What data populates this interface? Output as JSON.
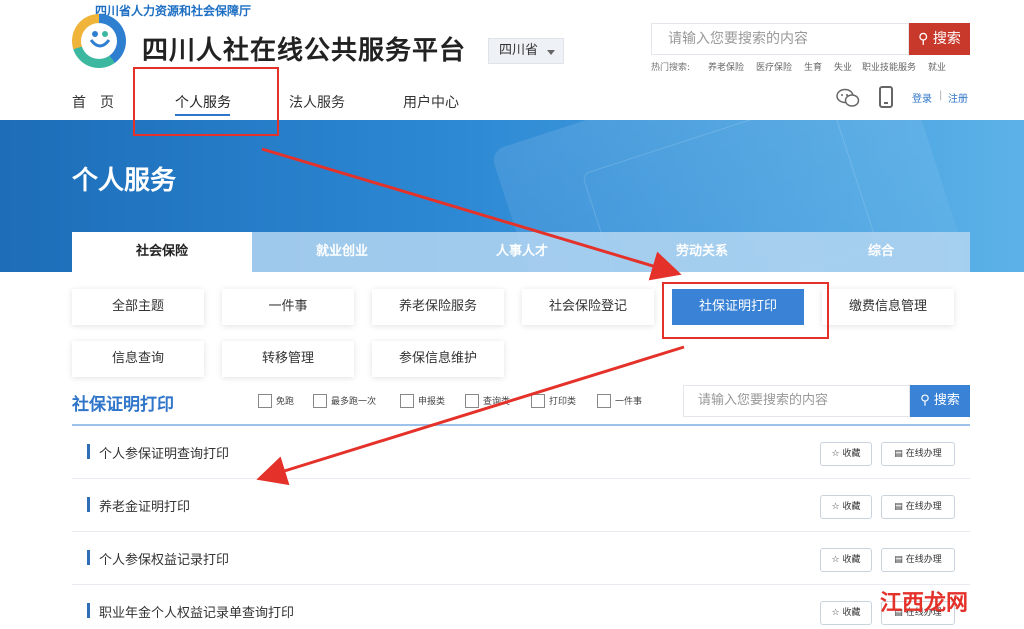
{
  "header": {
    "org_name": "四川省人力资源和社会保障厅",
    "site_title": "四川人社在线公共服务平台",
    "region": "四川省",
    "search_placeholder": "请输入您要搜索的内容",
    "search_button": "搜索",
    "hot_label": "热门搜索:",
    "hot_items": [
      "养老保险",
      "医疗保险",
      "生育",
      "失业",
      "职业技能服务",
      "就业"
    ],
    "nav": [
      "首　页",
      "个人服务",
      "法人服务",
      "用户中心"
    ],
    "login": "登录",
    "separator": "|",
    "register": "注册",
    "icons": {
      "wechat": "wechat-icon",
      "mobile": "mobile-icon",
      "search": "search-icon",
      "logo": "logo-icon"
    }
  },
  "banner": {
    "title": "个人服务"
  },
  "tabs": [
    "社会保险",
    "就业创业",
    "人事人才",
    "劳动关系",
    "综合"
  ],
  "topics": [
    "全部主题",
    "一件事",
    "养老保险服务",
    "社会保险登记",
    "社保证明打印",
    "缴费信息管理",
    "信息查询",
    "转移管理",
    "参保信息维护"
  ],
  "active_topic": "社保证明打印",
  "section": {
    "title": "社保证明打印",
    "filters": [
      "免跑",
      "最多跑一次",
      "申报类",
      "查询类",
      "打印类",
      "一件事"
    ],
    "search_placeholder": "请输入您要搜索的内容",
    "search_button": "搜索"
  },
  "items": [
    {
      "title": "个人参保证明查询打印",
      "fav": "收藏",
      "online": "在线办理"
    },
    {
      "title": "养老金证明打印",
      "fav": "收藏",
      "online": "在线办理"
    },
    {
      "title": "个人参保权益记录打印",
      "fav": "收藏",
      "online": "在线办理"
    },
    {
      "title": "职业年金个人权益记录单查询打印",
      "fav": "收藏",
      "online": "在线办理"
    }
  ],
  "watermark": "江西龙网",
  "colors": {
    "primary": "#3a82d6",
    "search_red": "#c8392c",
    "annotation": "#e4322b"
  }
}
